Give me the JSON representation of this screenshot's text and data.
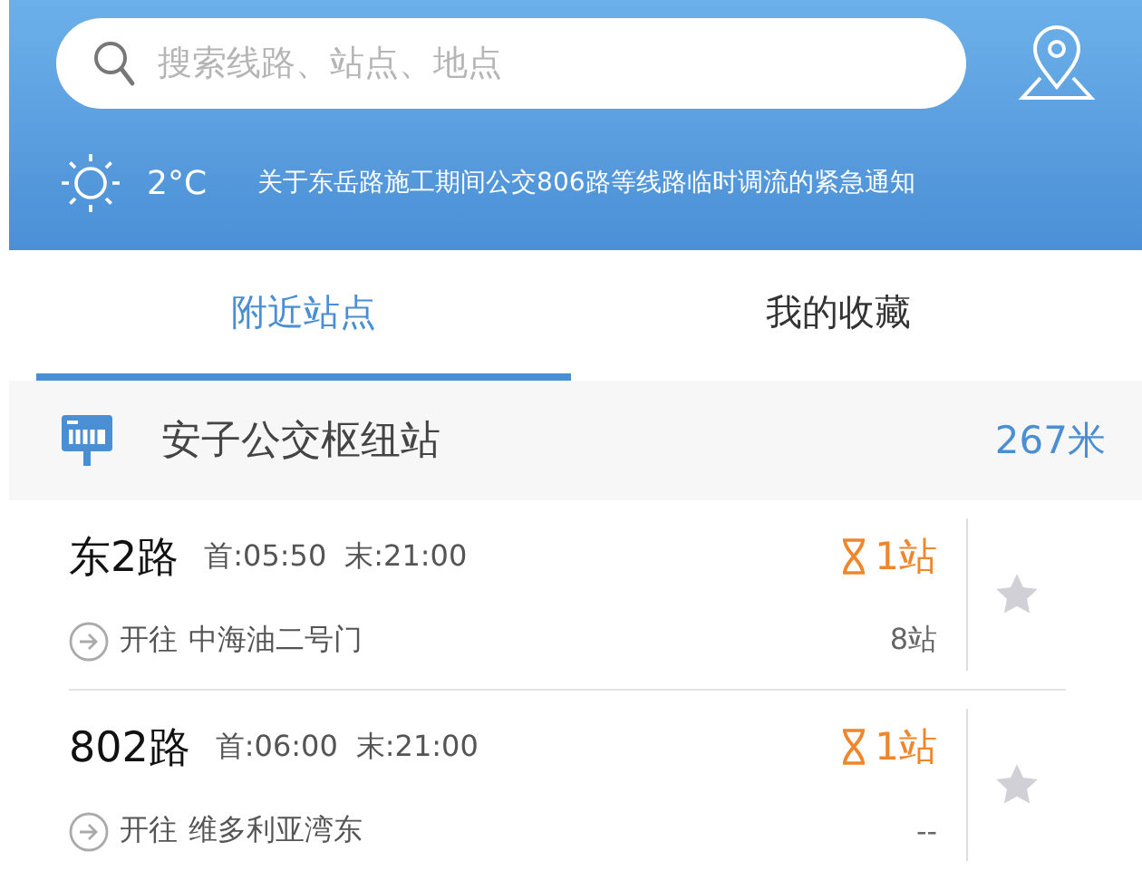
{
  "search": {
    "placeholder": "搜索线路、站点、地点"
  },
  "weather": {
    "temperature": "2°C",
    "notice": "关于东岳路施工期间公交806路等线路临时调流的紧急通知"
  },
  "tabs": [
    {
      "label": "附近站点",
      "selected": true
    },
    {
      "label": "我的收藏",
      "selected": false
    }
  ],
  "station": {
    "name": "安子公交枢纽站",
    "distance": "267米"
  },
  "routes": [
    {
      "name": "东2路",
      "first": "首:05:50",
      "last": "末:21:00",
      "arrival": "1站",
      "direction": "开往",
      "destination": "中海油二号门",
      "stops": "8站",
      "favorite": false
    },
    {
      "name": "802路",
      "first": "首:06:00",
      "last": "末:21:00",
      "arrival": "1站",
      "direction": "开往",
      "destination": "维多利亚湾东",
      "stops": "--",
      "favorite": false
    }
  ]
}
